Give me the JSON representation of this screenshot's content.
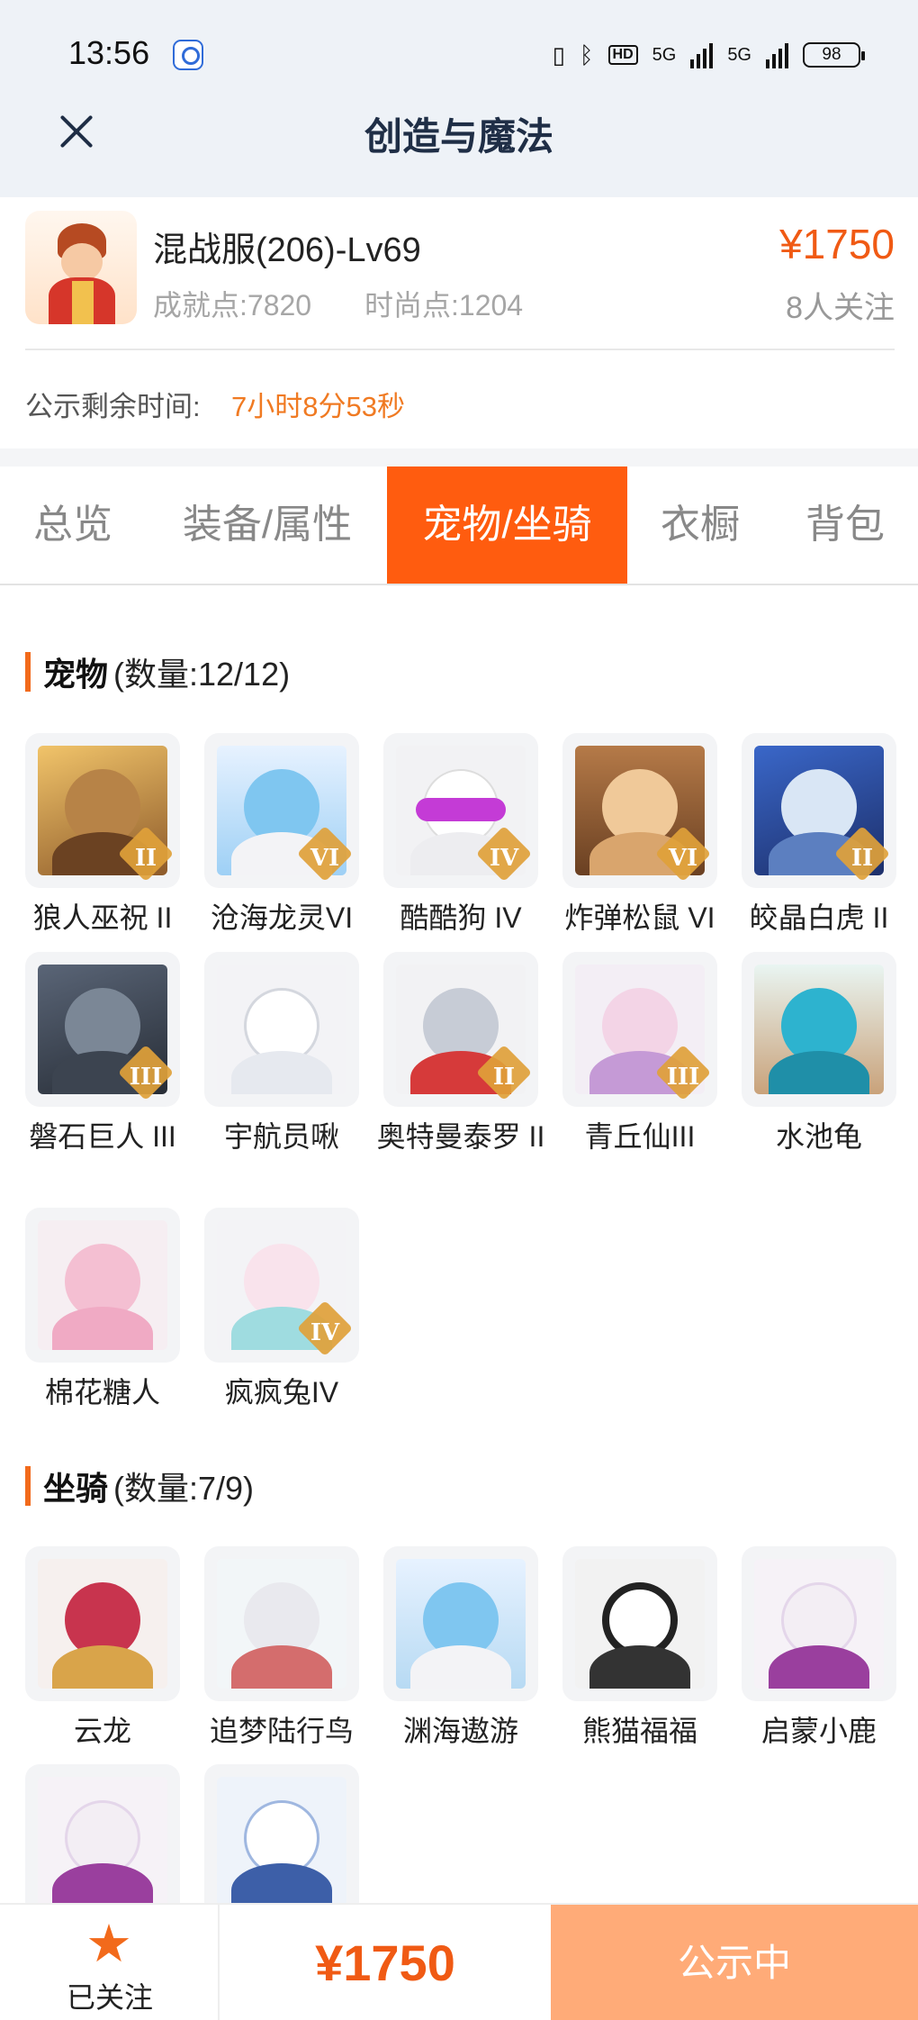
{
  "status_bar": {
    "time": "13:56",
    "battery": "98",
    "hd": "HD",
    "net1": "5G",
    "net2": "5G"
  },
  "header": {
    "title": "创造与魔法"
  },
  "listing": {
    "server": "混战服(206)-Lv69",
    "achievement": "成就点:7820",
    "fashion": "时尚点:1204",
    "price": "¥1750",
    "followers": "8人关注",
    "notice_label": "公示剩余时间:",
    "notice_value": "7小时8分53秒"
  },
  "tabs": [
    {
      "label": "总览"
    },
    {
      "label": "装备/属性"
    },
    {
      "label": "宠物/坐骑"
    },
    {
      "label": "衣橱"
    },
    {
      "label": "背包"
    }
  ],
  "pets": {
    "title": "宠物",
    "count": "(数量:12/12)",
    "items": [
      {
        "name": "狼人巫祝 II",
        "icon": "werewolf-pet-icon",
        "grade": "II"
      },
      {
        "name": "沧海龙灵VI",
        "icon": "dragon-spirit-pet-icon",
        "grade": "VI"
      },
      {
        "name": "酷酷狗 IV",
        "icon": "cool-dog-pet-icon",
        "grade": "IV"
      },
      {
        "name": "炸弹松鼠 VI",
        "icon": "bomb-squirrel-pet-icon",
        "grade": "VI"
      },
      {
        "name": "皎晶白虎 II",
        "icon": "white-tiger-pet-icon",
        "grade": "II"
      },
      {
        "name": "磐石巨人 III",
        "icon": "rock-giant-pet-icon",
        "grade": "III"
      },
      {
        "name": "宇航员啾",
        "icon": "astronaut-pet-icon",
        "grade": ""
      },
      {
        "name": "奥特曼泰罗 II",
        "icon": "ultraman-taro-pet-icon",
        "grade": "II"
      },
      {
        "name": "青丘仙III",
        "icon": "fox-fairy-pet-icon",
        "grade": "III"
      },
      {
        "name": "水池龟",
        "icon": "pond-turtle-pet-icon",
        "grade": ""
      },
      {
        "name": "棉花糖人",
        "icon": "cotton-candy-pet-icon",
        "grade": ""
      },
      {
        "name": "疯疯兔IV",
        "icon": "crazy-rabbit-pet-icon",
        "grade": "IV"
      }
    ]
  },
  "mounts": {
    "title": "坐骑",
    "count": "(数量:7/9)",
    "items": [
      {
        "name": "云龙",
        "icon": "cloud-dragon-mount-icon"
      },
      {
        "name": "追梦陆行鸟",
        "icon": "dream-bird-mount-icon"
      },
      {
        "name": "渊海遨游",
        "icon": "sea-traveler-mount-icon"
      },
      {
        "name": "熊猫福福",
        "icon": "panda-mount-icon"
      },
      {
        "name": "启蒙小鹿",
        "icon": "fawn-mount-icon"
      },
      {
        "name": "",
        "icon": "fawn-mount-2-icon"
      },
      {
        "name": "",
        "icon": "owl-mount-icon"
      }
    ]
  },
  "footer": {
    "follow_label": "已关注",
    "price": "¥1750",
    "status": "公示中"
  },
  "colors": {
    "accent": "#ff5c0f",
    "price": "#f05a14",
    "notice": "#f07a22",
    "status_button": "#ffab78"
  }
}
